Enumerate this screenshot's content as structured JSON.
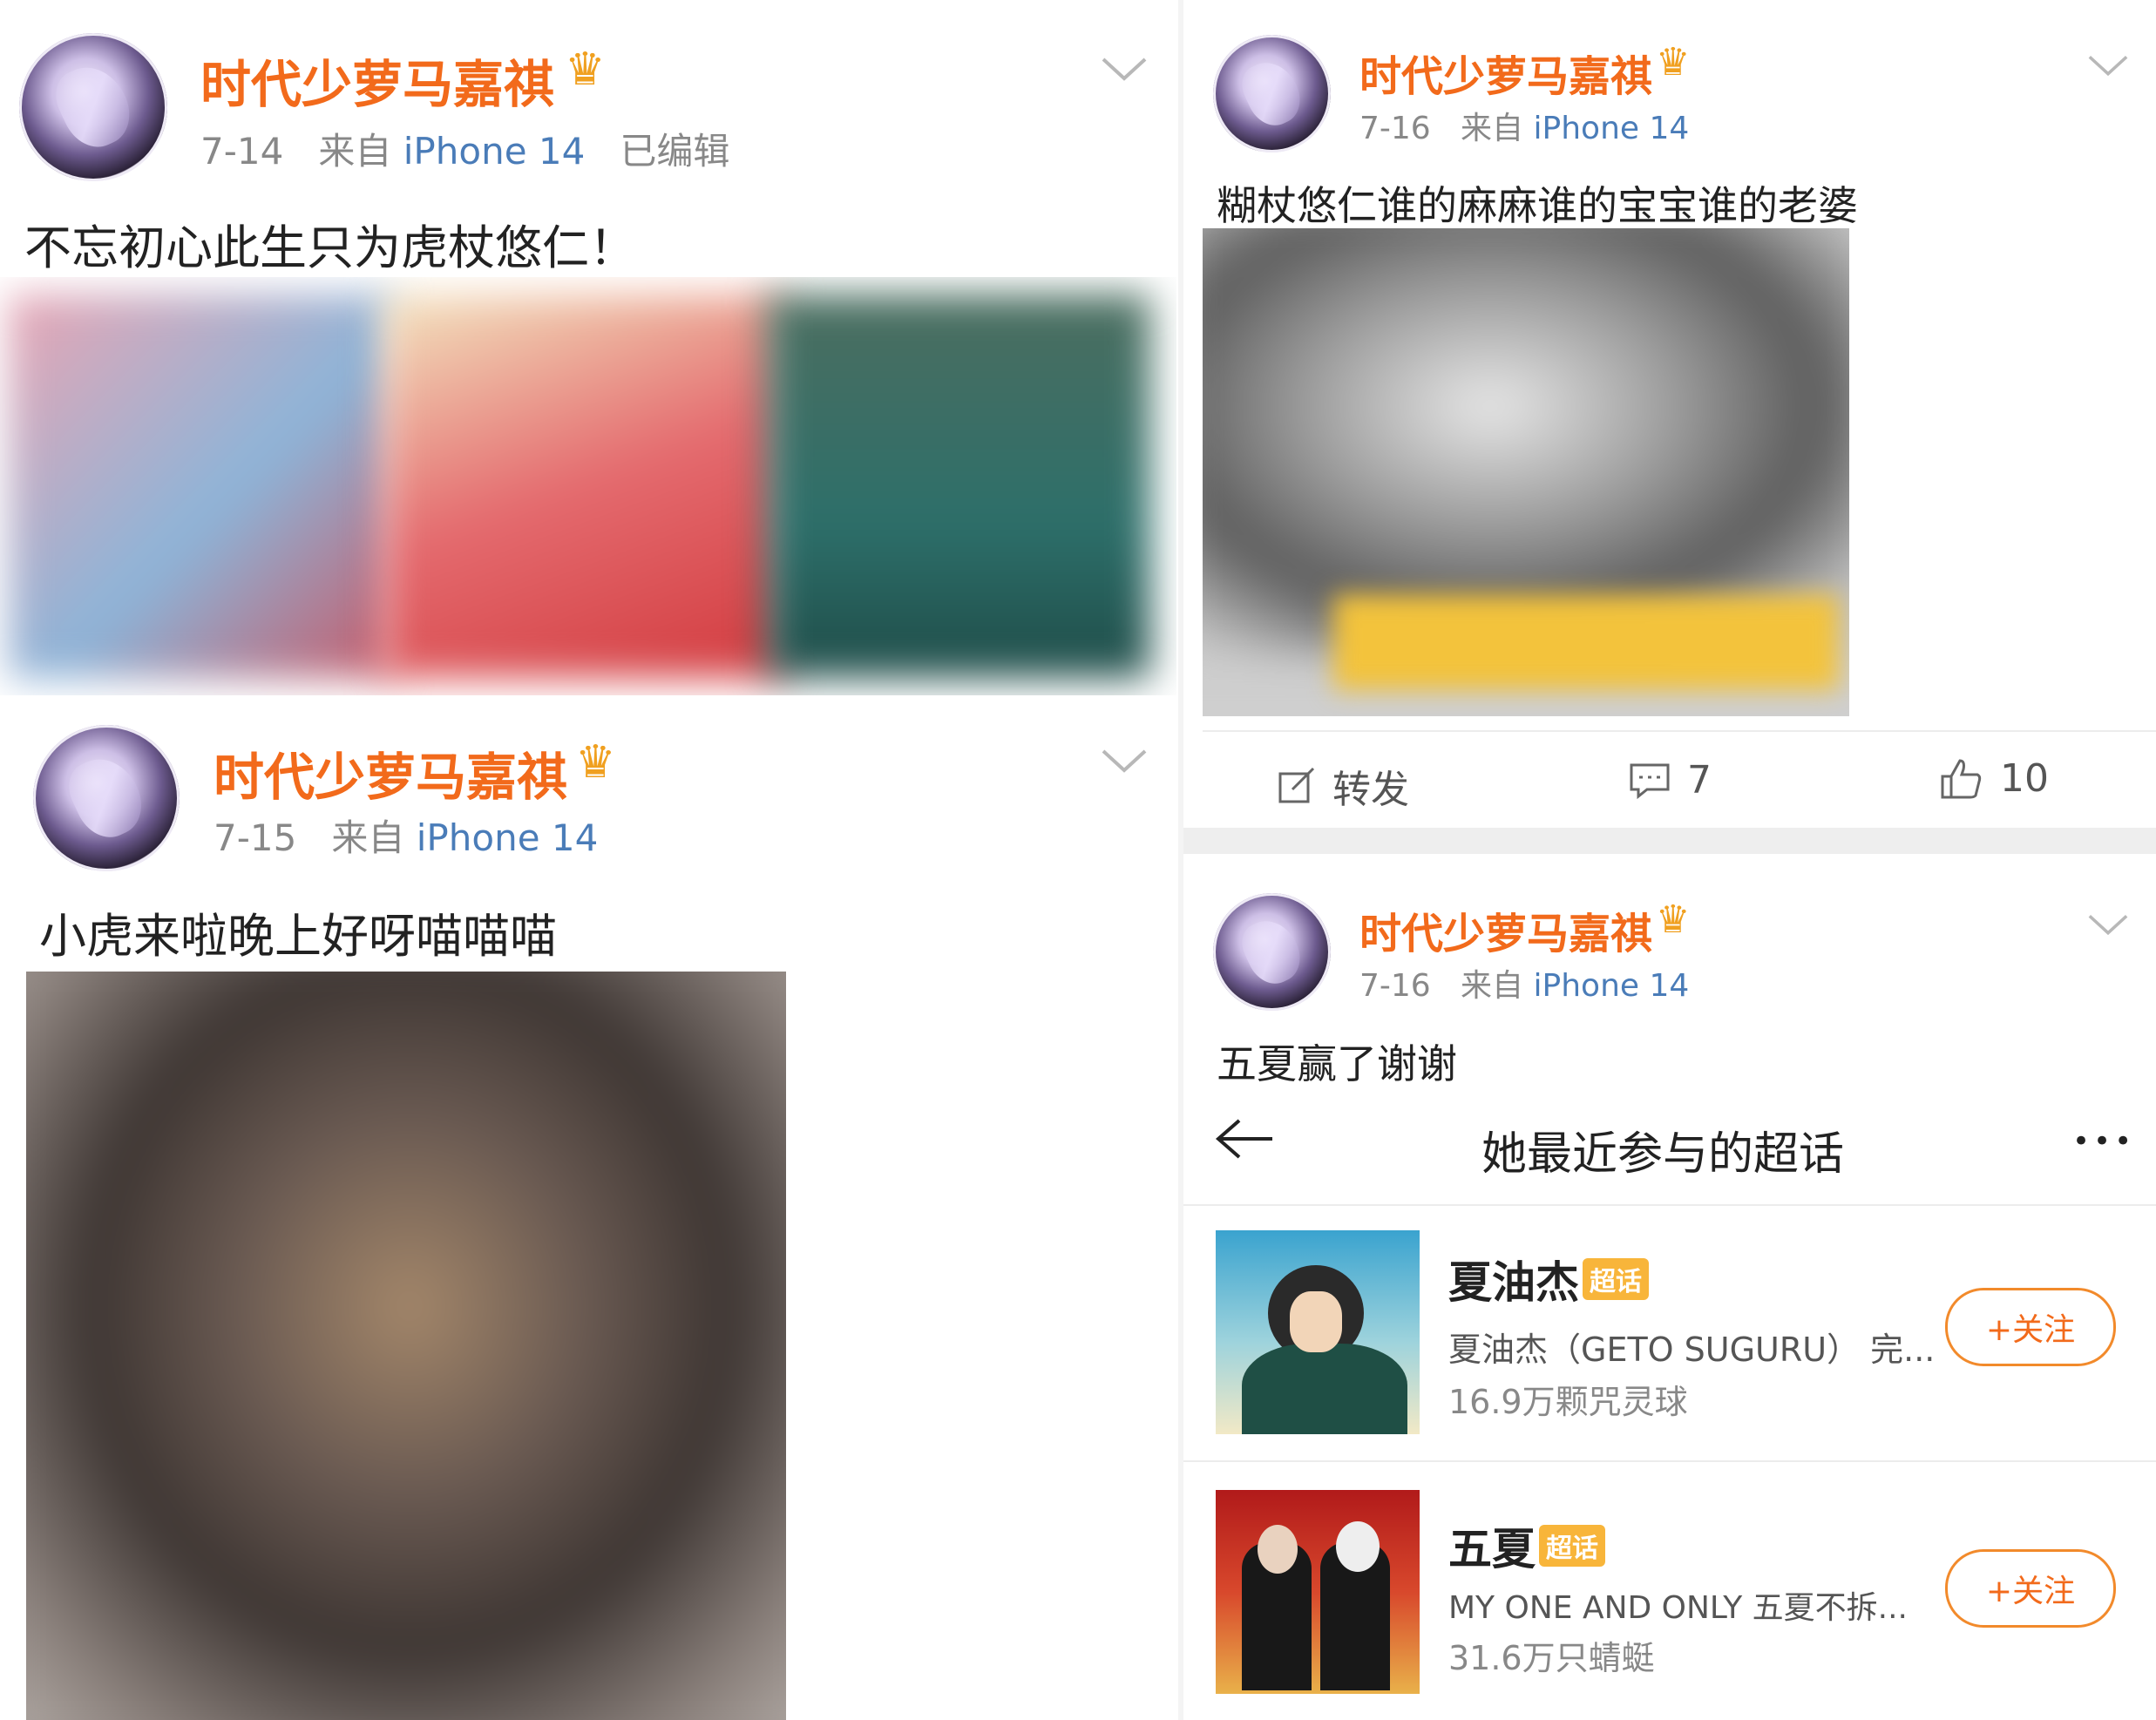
{
  "posts": [
    {
      "username": "时代少萝马嘉祺",
      "date": "7-14",
      "source_prefix": "来自",
      "device": "iPhone 14",
      "edited": "已编辑",
      "text": "不忘初心此生只为虎杖悠仁！"
    },
    {
      "username": "时代少萝马嘉祺",
      "date": "7-15",
      "source_prefix": "来自",
      "device": "iPhone 14",
      "text": "小虎来啦晚上好呀喵喵喵"
    },
    {
      "username": "时代少萝马嘉祺",
      "date": "7-16",
      "source_prefix": "来自",
      "device": "iPhone 14",
      "text": "糊杖悠仁谁的麻麻谁的宝宝谁的老婆",
      "actions": {
        "repost": "转发",
        "comments": "7",
        "likes": "10"
      }
    },
    {
      "username": "时代少萝马嘉祺",
      "date": "7-16",
      "source_prefix": "来自",
      "device": "iPhone 14",
      "text": "五夏赢了谢谢"
    }
  ],
  "supertopic_panel": {
    "title": "她最近参与的超话",
    "more": "•••",
    "topics": [
      {
        "name": "夏油杰",
        "badge": "超话",
        "desc": "夏油杰（GETO SUGURU） 完...",
        "count": "16.9万颗咒灵球",
        "follow": "+关注"
      },
      {
        "name": "五夏",
        "badge": "超话",
        "desc": "MY ONE AND ONLY  五夏不拆...",
        "count": "31.6万只蜻蜓",
        "follow": "+关注"
      }
    ]
  },
  "icons": [
    "crown-icon",
    "chevron-down-icon",
    "edit-share-icon",
    "comment-icon",
    "thumbs-up-icon",
    "back-arrow-icon",
    "more-icon"
  ],
  "colors": {
    "username": "#f26a1b",
    "device": "#4a7cb8",
    "badge": "#f8b53a"
  }
}
